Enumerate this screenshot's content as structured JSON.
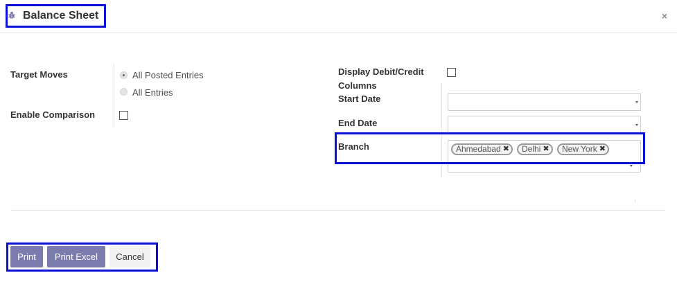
{
  "header": {
    "title": "Balance Sheet",
    "icon": "bug-icon",
    "close_label": "×"
  },
  "form": {
    "target_moves": {
      "label": "Target Moves",
      "options": [
        {
          "label": "All Posted Entries",
          "selected": true
        },
        {
          "label": "All Entries",
          "selected": false
        }
      ]
    },
    "enable_comparison": {
      "label": "Enable Comparison",
      "checked": false
    },
    "display_debit_credit": {
      "label_line1": "Display Debit/Credit",
      "label_line2": "Columns",
      "checked": false
    },
    "start_date": {
      "label": "Start Date",
      "value": ""
    },
    "end_date": {
      "label": "End Date",
      "value": ""
    },
    "branch": {
      "label": "Branch",
      "tags": [
        "Ahmedabad",
        "Delhi",
        "New York"
      ]
    }
  },
  "footer": {
    "print_label": "Print",
    "print_excel_label": "Print Excel",
    "cancel_label": "Cancel"
  },
  "colors": {
    "primary": "#7c7bad",
    "highlight": "#0a10d8"
  }
}
